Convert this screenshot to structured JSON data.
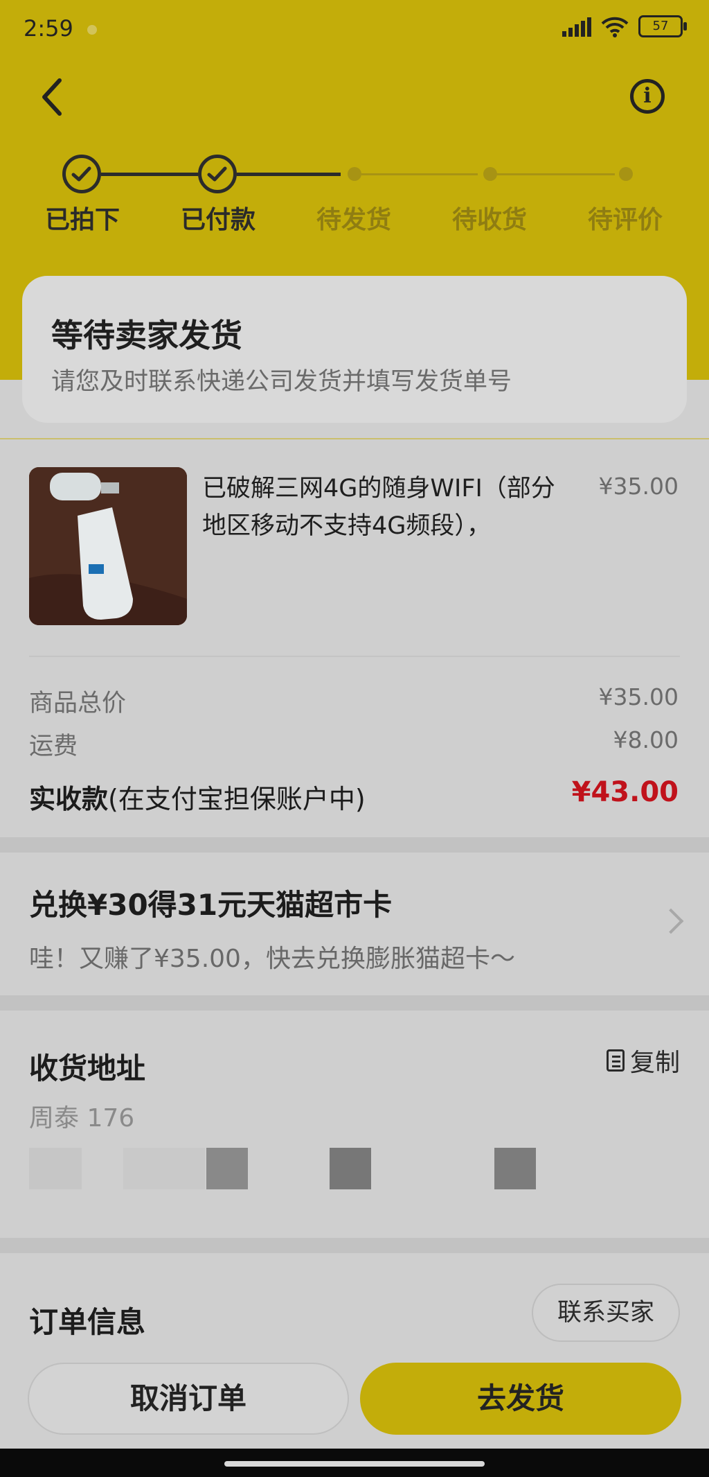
{
  "status_bar": {
    "time": "2:59",
    "battery": "57"
  },
  "steps": [
    {
      "label": "已拍下",
      "done": true
    },
    {
      "label": "已付款",
      "done": true
    },
    {
      "label": "待发货",
      "done": false
    },
    {
      "label": "待收货",
      "done": false
    },
    {
      "label": "待评价",
      "done": false
    }
  ],
  "status_card": {
    "title": "等待卖家发货",
    "subtitle": "请您及时联系快递公司发货并填写发货单号"
  },
  "goods": {
    "title": "已破解三网4G的随身WIFI（部分地区移动不支持4G频段），",
    "price": "¥35.00"
  },
  "summary": {
    "total_label": "商品总价",
    "total_value": "¥35.00",
    "shipping_label": "运费",
    "shipping_value": "¥8.00",
    "paid_label_strong": "实收款",
    "paid_label_note": "(在支付宝担保账户中)",
    "paid_value": "¥43.00"
  },
  "promo": {
    "title": "兑换¥30得31元天猫超市卡",
    "subtitle": "哇！又赚了¥35.00，快去兑换膨胀猫超卡～"
  },
  "address": {
    "title": "收货地址",
    "copy_label": "复制",
    "name": "周泰 176"
  },
  "order_info": {
    "title": "订单信息",
    "contact_label": "联系买家"
  },
  "actions": {
    "cancel_label": "取消订单",
    "ship_label": "去发货"
  },
  "colors": {
    "brand_yellow": "#c3ad0a",
    "price_red": "#c0121b"
  }
}
